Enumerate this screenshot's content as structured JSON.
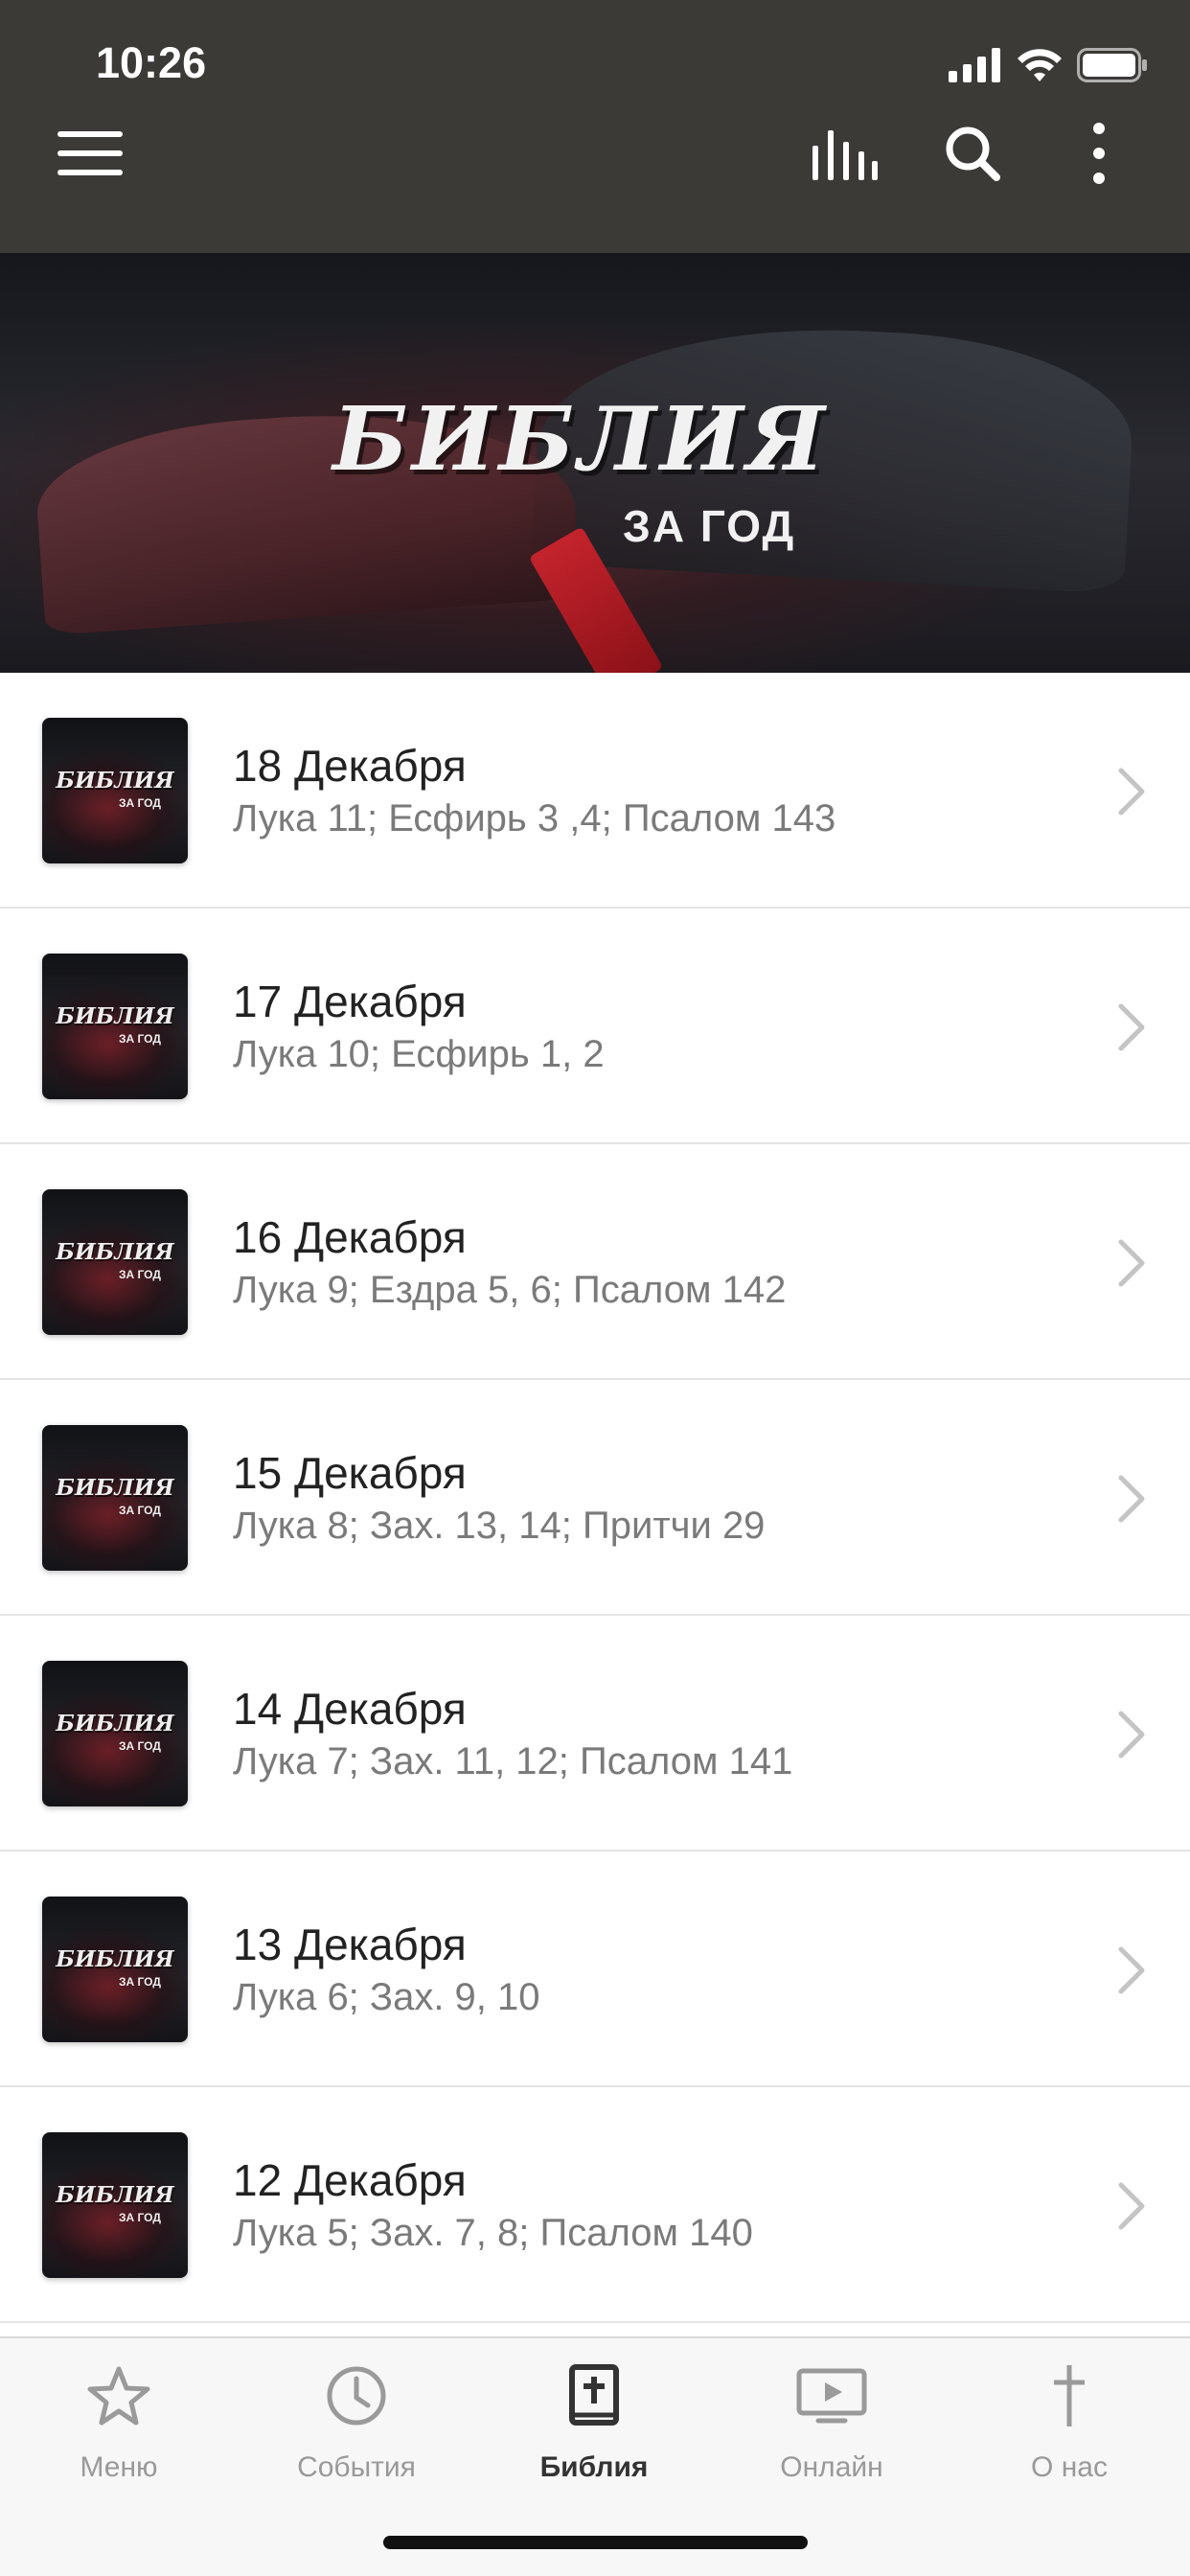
{
  "status_bar": {
    "time": "10:26"
  },
  "navbar": {
    "menu_icon": "hamburger-icon",
    "stats_icon": "bars-icon",
    "search_icon": "search-icon",
    "more_icon": "more-vertical-icon"
  },
  "hero": {
    "title": "БИБЛИЯ",
    "subtitle": "ЗА ГОД"
  },
  "thumb": {
    "title": "БИБЛИЯ",
    "subtitle": "ЗА ГОД"
  },
  "list": [
    {
      "title": "18 Декабря",
      "subtitle": "Лука 11; Есфирь 3 ,4; Псалом 143"
    },
    {
      "title": "17 Декабря",
      "subtitle": "Лука 10; Есфирь 1, 2"
    },
    {
      "title": "16 Декабря",
      "subtitle": "Лука 9; Ездра 5, 6; Псалом 142"
    },
    {
      "title": "15 Декабря",
      "subtitle": "Лука 8; Зах. 13, 14; Притчи 29"
    },
    {
      "title": "14 Декабря",
      "subtitle": "Лука 7; Зах. 11, 12; Псалом 141"
    },
    {
      "title": "13 Декабря",
      "subtitle": "Лука 6; Зах. 9, 10"
    },
    {
      "title": "12 Декабря",
      "subtitle": "Лука 5; Зах. 7, 8; Псалом 140"
    }
  ],
  "tabs": [
    {
      "label": "Меню",
      "icon": "star-icon"
    },
    {
      "label": "События",
      "icon": "clock-icon"
    },
    {
      "label": "Библия",
      "icon": "bible-icon"
    },
    {
      "label": "Онлайн",
      "icon": "tv-play-icon"
    },
    {
      "label": "О нас",
      "icon": "cross-icon"
    }
  ],
  "active_tab": "Библия",
  "colors": {
    "navbar_bg": "#3b3a37",
    "tab_active": "#333333",
    "tab_inactive": "#999999"
  }
}
